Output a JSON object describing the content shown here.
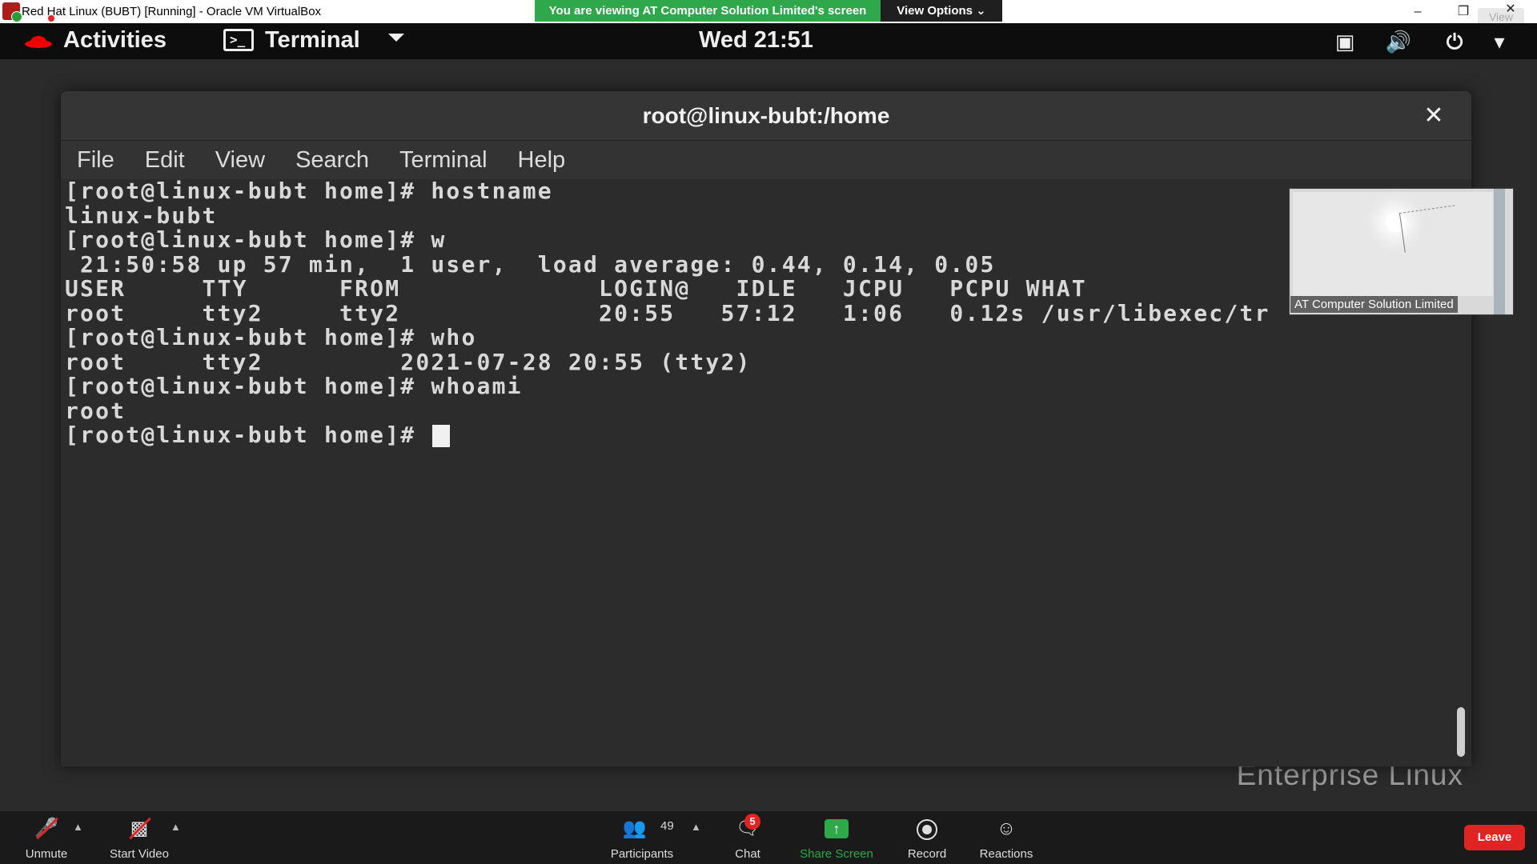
{
  "window": {
    "title": "Red Hat Linux (BUBT) [Running] - Oracle VM VirtualBox",
    "minimize_icon": "minimize-icon",
    "restore_icon": "restore-icon",
    "close_icon": "close-icon",
    "view_button": "View"
  },
  "share_banner": {
    "text": "You are viewing AT Computer Solution Limited's screen",
    "view_options": "View Options ⌄",
    "banner_color": "#2ea84a"
  },
  "gnome": {
    "activities": "Activities",
    "app_menu": "Terminal",
    "clock": "Wed 21:51",
    "icons": [
      "network-icon",
      "volume-icon",
      "power-icon",
      "system-menu-caret-icon"
    ]
  },
  "terminal": {
    "title": "root@linux-bubt:/home",
    "menu": [
      "File",
      "Edit",
      "View",
      "Search",
      "Terminal",
      "Help"
    ],
    "lines": [
      "[root@linux-bubt home]# hostname",
      "linux-bubt",
      "[root@linux-bubt home]# w",
      " 21:50:58 up 57 min,  1 user,  load average: 0.44, 0.14, 0.05",
      "USER     TTY      FROM             LOGIN@   IDLE   JCPU   PCPU WHAT",
      "root     tty2     tty2             20:55   57:12   1:06   0.12s /usr/libexec/tr",
      "[root@linux-bubt home]# who",
      "root     tty2         2021-07-28 20:55 (tty2)",
      "[root@linux-bubt home]# whoami",
      "root",
      "[root@linux-bubt home]# "
    ]
  },
  "desktop": {
    "watermark": "Enterprise Linux"
  },
  "video": {
    "participant_name": "AT Computer Solution Limited"
  },
  "zoom_toolbar": {
    "unmute": "Unmute",
    "start_video": "Start Video",
    "participants": "Participants",
    "participants_count": "49",
    "chat": "Chat",
    "chat_badge": "5",
    "share_screen": "Share Screen",
    "record": "Record",
    "reactions": "Reactions",
    "leave": "Leave",
    "accent_green": "#2ea84a",
    "accent_red": "#e02424"
  }
}
